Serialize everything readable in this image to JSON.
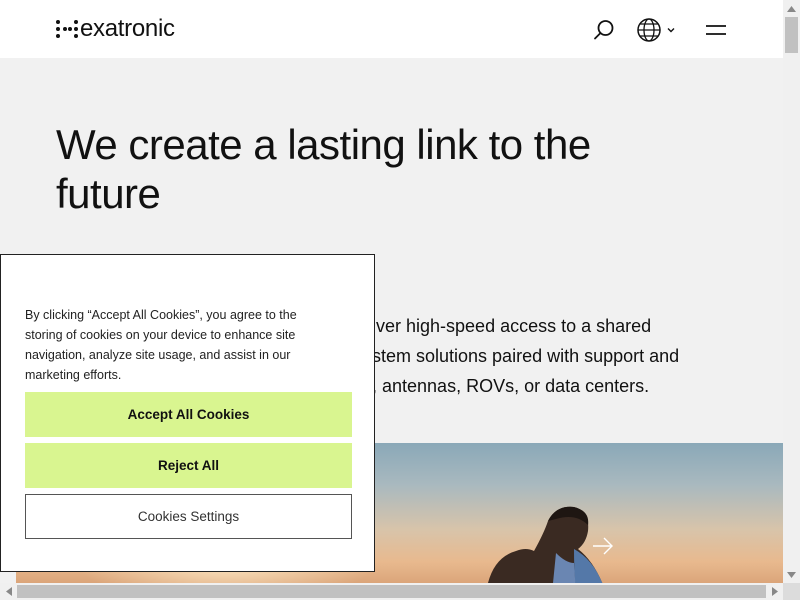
{
  "header": {
    "logo_text": "exatronic",
    "logo_alt": "Hexatronic",
    "icons": {
      "search": "search-icon",
      "globe": "globe-icon",
      "chevron": "chevron-down-icon",
      "menu": "hamburger-menu-icon"
    }
  },
  "hero": {
    "title": "We create a lasting link to the future",
    "desc_line1": "iver high-speed access to a shared",
    "desc_line2": "stem solutions paired with support and",
    "desc_line3": ", antennas, ROVs, or data centers."
  },
  "carousel": {
    "next_icon": "arrow-right-icon"
  },
  "cookie_banner": {
    "text": "By clicking “Accept All Cookies”, you agree to the storing of cookies on your device to enhance site navigation, analyze site usage, and assist in our marketing efforts.",
    "accept_label": "Accept All Cookies",
    "reject_label": "Reject All",
    "settings_label": "Cookies Settings"
  },
  "colors": {
    "accent_button": "#d9f590",
    "page_bg": "#f1f1f1",
    "header_bg": "#ffffff",
    "text": "#111111"
  }
}
